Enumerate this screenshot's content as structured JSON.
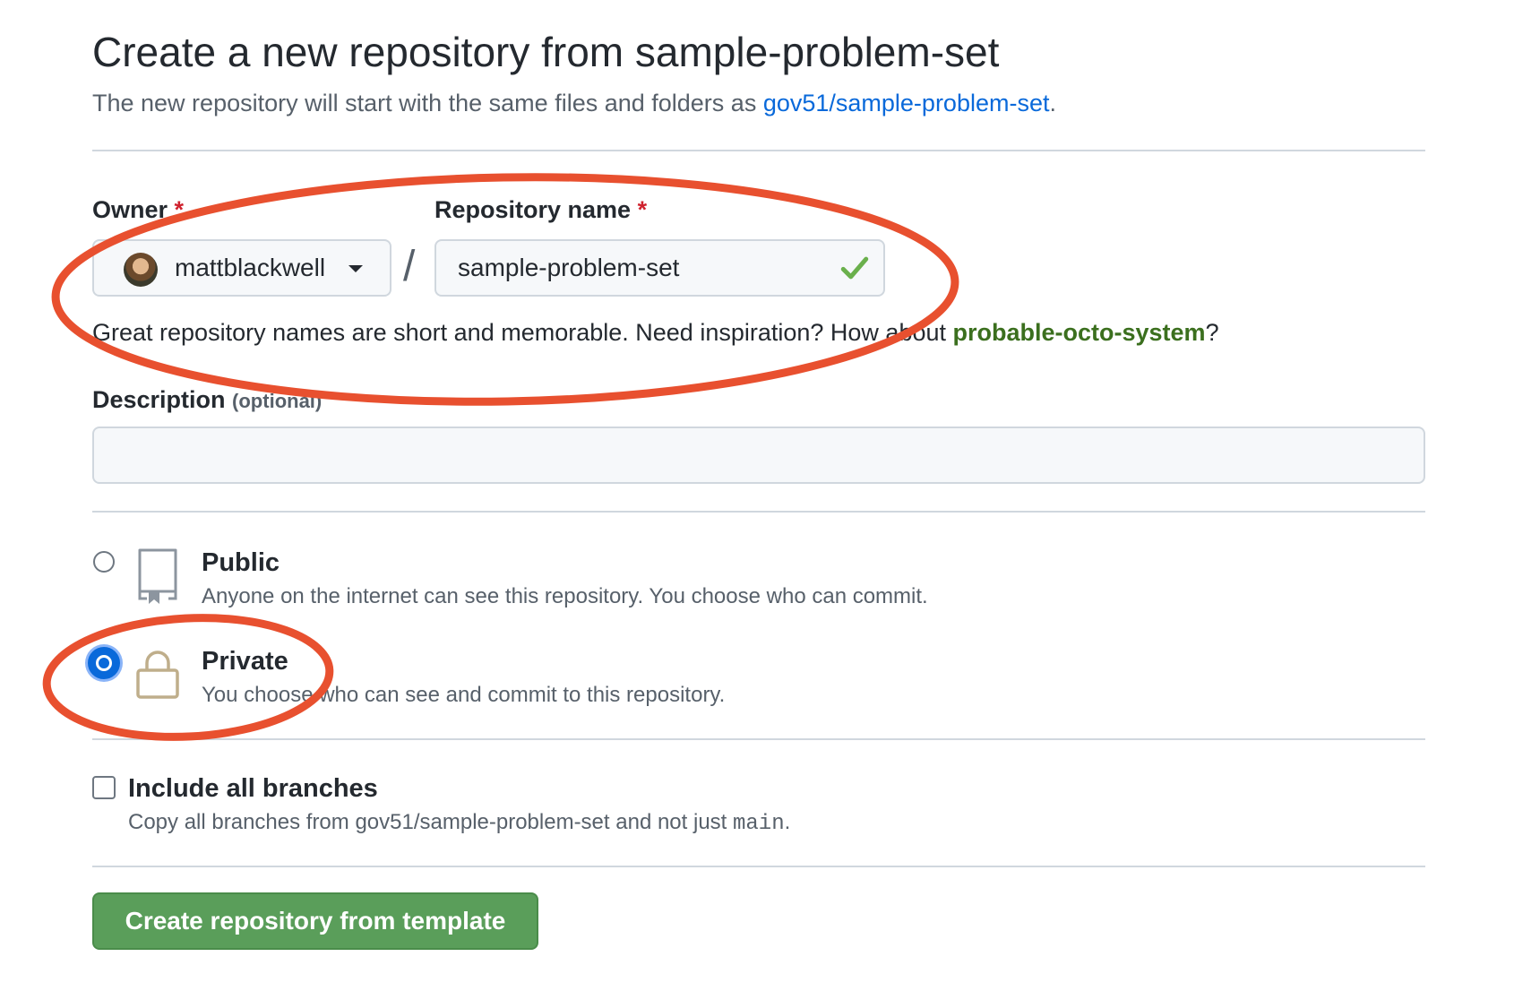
{
  "header": {
    "title": "Create a new repository from sample-problem-set",
    "subtitle_prefix": "The new repository will start with the same files and folders as ",
    "template_link": "gov51/sample-problem-set",
    "subtitle_suffix": "."
  },
  "owner": {
    "label": "Owner",
    "required_mark": "*",
    "value": "mattblackwell",
    "icon": "chevron-down-icon"
  },
  "separator": "/",
  "repo_name": {
    "label": "Repository name",
    "required_mark": "*",
    "value": "sample-problem-set",
    "valid_icon": "check-icon"
  },
  "hint": {
    "prefix": "Great repository names are short and memorable. Need inspiration? How about ",
    "suggestion": "probable-octo-system",
    "suffix": "?"
  },
  "description": {
    "label": "Description",
    "optional": "(optional)",
    "value": "",
    "placeholder": ""
  },
  "visibility": {
    "selected": "Private",
    "options": [
      {
        "title": "Public",
        "description": "Anyone on the internet can see this repository. You choose who can commit.",
        "icon": "repo-icon"
      },
      {
        "title": "Private",
        "description": "You choose who can see and commit to this repository.",
        "icon": "lock-icon"
      }
    ]
  },
  "branches": {
    "label": "Include all branches",
    "description_prefix": "Copy all branches from gov51/sample-problem-set and not just ",
    "branch_code": "main",
    "description_suffix": ".",
    "checked": false
  },
  "submit": {
    "label": "Create repository from template"
  },
  "colors": {
    "link_blue": "#0969da",
    "suggestion_green": "#3b6f1e",
    "button_green": "#5a9e5a",
    "annotation_red": "#e8502f",
    "check_green": "#6ab04c",
    "lock_tan": "#bfae8b"
  }
}
